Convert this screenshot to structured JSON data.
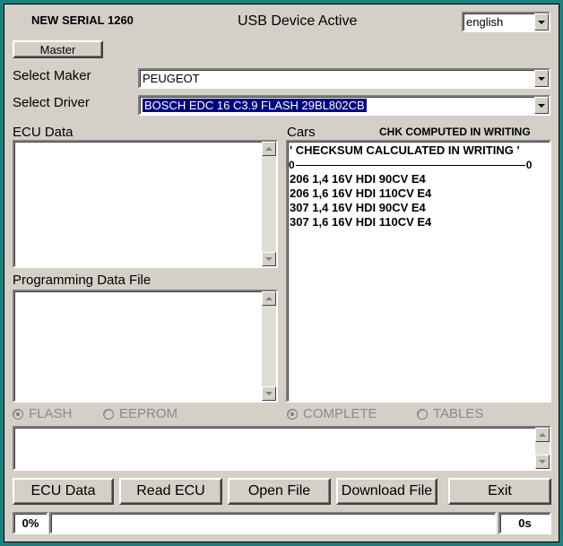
{
  "header": {
    "serial": "NEW SERIAL 1260",
    "status": "USB Device Active",
    "language": "english"
  },
  "master_button": "Master",
  "maker": {
    "label": "Select Maker",
    "value": "PEUGEOT"
  },
  "driver": {
    "label": "Select Driver",
    "value": "BOSCH EDC 16 C3.9 FLASH 29BL802CB"
  },
  "ecu_data": {
    "label": "ECU Data"
  },
  "programming": {
    "label": "Programming Data File"
  },
  "cars": {
    "label": "Cars",
    "note": "CHK COMPUTED IN WRITING",
    "checksum_line": "' CHECKSUM CALCULATED IN WRITING '",
    "scale_left": "0",
    "scale_right": "0",
    "items": [
      "206 1,4 16V HDI 90CV E4",
      "206 1,6 16V HDI 110CV E4",
      "307 1,4 16V HDI 90CV E4",
      "307 1,6 16V HDI 110CV E4"
    ]
  },
  "radios": {
    "flash": "FLASH",
    "eeprom": "EEPROM",
    "complete": "COMPLETE",
    "tables": "TABLES"
  },
  "buttons": {
    "ecu_data": "ECU Data",
    "read_ecu": "Read ECU",
    "open_file": "Open File",
    "download_file": "Download File",
    "exit": "Exit"
  },
  "status_bar": {
    "percent": "0%",
    "time": "0s",
    "progress": 0
  }
}
